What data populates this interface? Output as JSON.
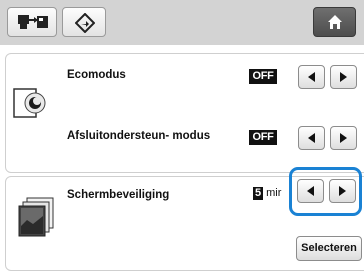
{
  "topbar": {
    "machine_icon": "machine-connect-icon",
    "pattern_icon": "diamond-arrow-icon",
    "home_icon": "home-icon"
  },
  "settings": [
    {
      "label": "Ecomodus",
      "value": "OFF",
      "icon": "eco-sleep-icon"
    },
    {
      "label": "Afsluitondersteun- modus",
      "value": "OFF"
    },
    {
      "label": "Schermbeveiliging",
      "value_number": "5",
      "value_unit": "mir",
      "icon": "screensaver-images-icon"
    }
  ],
  "buttons": {
    "select_label": "Selecteren"
  },
  "colors": {
    "topbar": "#d3d3d3",
    "highlight": "#1a82d4",
    "home_button": "#5a5a5a"
  }
}
